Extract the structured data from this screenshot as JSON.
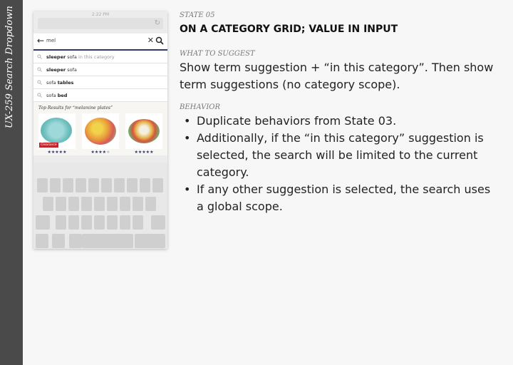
{
  "sidebar": {
    "title": "UX-259 Search Dropdown"
  },
  "phone": {
    "status_time": "2:22 PM",
    "search_value": "mel",
    "suggestions": [
      {
        "bold": "sleeper",
        "rest": " sofa",
        "scope": " in this category"
      },
      {
        "bold": "sleeper",
        "rest": " sofa",
        "scope": ""
      },
      {
        "bold": "",
        "rest": "sofa ",
        "bold2": "tables"
      },
      {
        "bold": "",
        "rest": "sofa ",
        "bold2": "bed"
      }
    ],
    "results_title": "Top Results for “melamine plates”",
    "clearance_badge": "Clearance",
    "products": [
      {
        "stars": "★★★★★",
        "empty": ""
      },
      {
        "stars": "★★★★",
        "empty": "★"
      },
      {
        "stars": "★★★★★",
        "empty": ""
      }
    ]
  },
  "content": {
    "state_label": "STATE 05",
    "state_title": "ON A CATEGORY GRID; VALUE IN INPUT",
    "suggest_label": "WHAT TO SUGGEST",
    "suggest_text": "Show term suggestion + “in this category”. Then show term suggestions (no category scope).",
    "behavior_label": "BEHAVIOR",
    "behaviors": [
      "Duplicate behaviors from State 03.",
      "Additionally, if the “in this category” suggestion is selected, the search will be limited to the current category.",
      "If any other suggestion is selected, the search uses a global scope."
    ]
  }
}
